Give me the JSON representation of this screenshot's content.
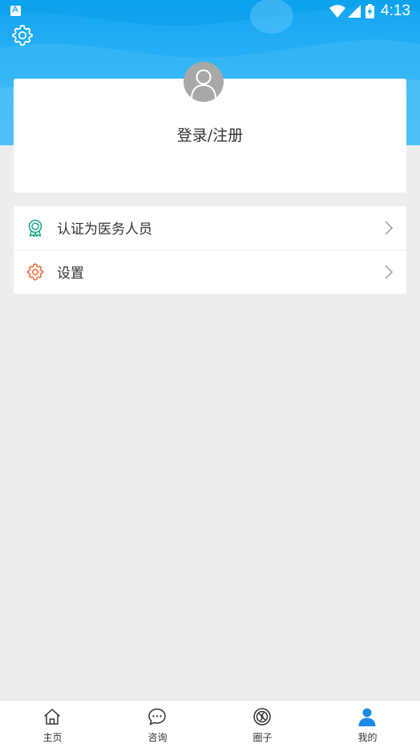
{
  "status_bar": {
    "time": "4:13",
    "icons": [
      "wifi-icon",
      "signal-icon",
      "battery-charging-icon"
    ]
  },
  "header": {
    "settings_icon": "gear-icon"
  },
  "profile": {
    "avatar_icon": "user-avatar-icon",
    "login_label": "登录/注册"
  },
  "menu": {
    "items": [
      {
        "label": "认证为医务人员",
        "icon": "badge-icon",
        "color": "#1aab8a"
      },
      {
        "label": "设置",
        "icon": "gear-icon",
        "color": "#f06b3a"
      }
    ]
  },
  "bottom_nav": {
    "items": [
      {
        "label": "主页",
        "icon": "home-icon"
      },
      {
        "label": "咨询",
        "icon": "chat-icon"
      },
      {
        "label": "圈子",
        "icon": "circle-icon"
      },
      {
        "label": "我的",
        "icon": "user-icon"
      }
    ],
    "active_index": 3,
    "active_color": "#1a8ce8"
  },
  "colors": {
    "header_blue": "#1aa9f2",
    "background": "#ededed"
  }
}
